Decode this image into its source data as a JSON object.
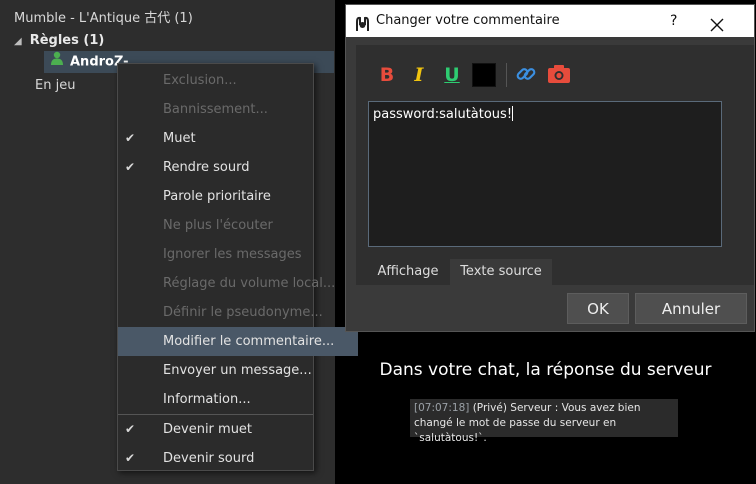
{
  "tree": {
    "server": "Mumble - L'Antique 古代 (1)",
    "channel": "Règles (1)",
    "user": "AndroZ-",
    "channel2": "En jeu"
  },
  "context_menu": {
    "items": [
      {
        "label": "Exclusion...",
        "enabled": false,
        "checked": false
      },
      {
        "label": "Bannissement...",
        "enabled": false,
        "checked": false
      },
      {
        "label": "Muet",
        "enabled": true,
        "checked": true
      },
      {
        "label": "Rendre sourd",
        "enabled": true,
        "checked": true
      },
      {
        "label": "Parole prioritaire",
        "enabled": true,
        "checked": false
      },
      {
        "label": "Ne plus l'écouter",
        "enabled": false,
        "checked": false
      },
      {
        "label": "Ignorer les messages",
        "enabled": false,
        "checked": false
      },
      {
        "label": "Réglage du volume local...",
        "enabled": false,
        "checked": false
      },
      {
        "label": "Définir le pseudonyme...",
        "enabled": false,
        "checked": false
      },
      {
        "label": "Modifier le commentaire...",
        "enabled": true,
        "checked": false,
        "highlighted": true
      },
      {
        "label": "Envoyer un message...",
        "enabled": true,
        "checked": false
      },
      {
        "label": "Information...",
        "enabled": true,
        "checked": false
      },
      {
        "label": "Devenir muet",
        "enabled": true,
        "checked": true
      },
      {
        "label": "Devenir sourd",
        "enabled": true,
        "checked": true
      }
    ]
  },
  "dialog": {
    "title": "Changer votre commentaire",
    "help": "?",
    "toolbar": {
      "bold": "B",
      "italic": "I",
      "underline": "U",
      "bold_color": "#e74c3c",
      "italic_color": "#f1c40f",
      "underline_color": "#2ecc71",
      "text_color": "#000000",
      "link_icon": "link-icon",
      "image_icon": "camera-icon"
    },
    "editor_text": "password:salutàtous!",
    "tabs": {
      "display": "Affichage",
      "source": "Texte source"
    },
    "buttons": {
      "ok": "OK",
      "cancel": "Annuler"
    }
  },
  "caption": "Dans votre chat, la réponse du serveur",
  "chat": {
    "timestamp": "[07:07:18]",
    "message": " (Privé) Serveur : Vous avez bien changé le mot de passe du serveur en `salutàtous!`."
  }
}
